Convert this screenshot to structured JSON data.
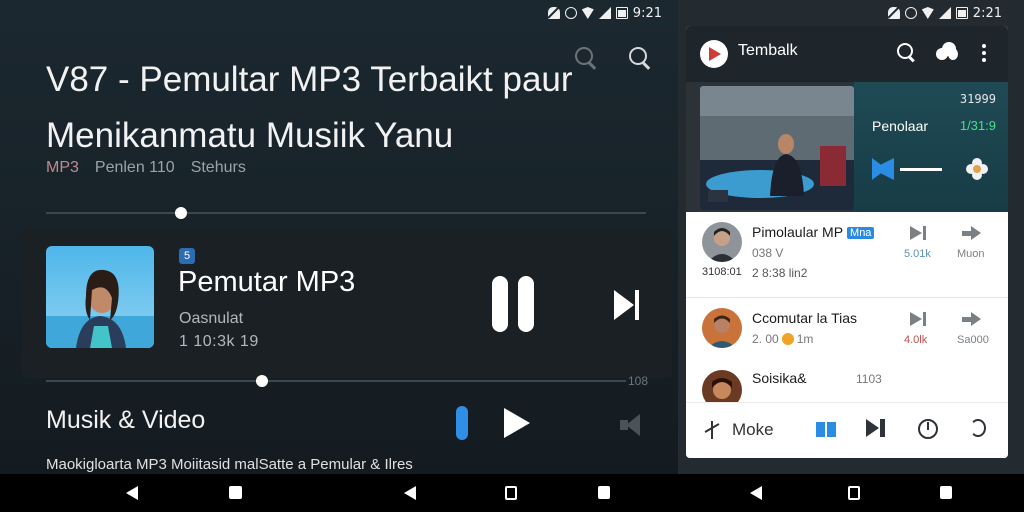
{
  "left_screen": {
    "status_time": "9:21",
    "page_title": "V87 - Pemultar MP3 Terbaikt paur Menikanmatu Musiik Yanu",
    "meta": {
      "type": "MP3",
      "count": "Penlen 110",
      "status": "Stehurs"
    },
    "now_playing": {
      "badge": "5",
      "title": "Pemutar MP3",
      "subtitle": "Oasnulat",
      "detail": "1 10:3k  19"
    },
    "time_end": "108",
    "section_title": "Musik & Video",
    "description": "Maokigloarta MP3 Moiitasid malSatte a Pemular & Ilres"
  },
  "right_screen": {
    "status_time": "2:21",
    "app_title": "Tembalk",
    "hero": {
      "code": "31999",
      "label": "Penolaar",
      "value": "1/31:9"
    },
    "tracks": [
      {
        "title": "Pimolaular MP",
        "tag": "Mna",
        "sub": "038 V",
        "sub2": "2 8:38 lin2",
        "left": "3108:01",
        "label1": "5.01k",
        "label2": "Muon",
        "label1_red": false
      },
      {
        "title": "Ccomutar la Tias",
        "tag": "",
        "sub": "2. 00",
        "sub_tail": "1m",
        "sub2": "",
        "left": "",
        "label1": "4.0lk",
        "label2": "Sa000",
        "label1_red": true
      },
      {
        "title": "Soisika&",
        "tag": "",
        "sub": "",
        "sub2": "",
        "left": "",
        "label1": "",
        "label2": "",
        "extra": "1103",
        "label1_red": false
      }
    ],
    "bottom_more_label": "Moke"
  },
  "colors": {
    "accent_blue": "#2a8ce5",
    "green_value": "#47e08a",
    "dark_bg": "#1c2830"
  },
  "icons": [
    "search-icon",
    "pause-icon",
    "next-icon",
    "play-icon",
    "volume-icon",
    "more-vert-icon",
    "cloud-icon",
    "timer-icon",
    "sync-icon",
    "library-icon",
    "back-icon",
    "home-icon",
    "recents-icon"
  ]
}
